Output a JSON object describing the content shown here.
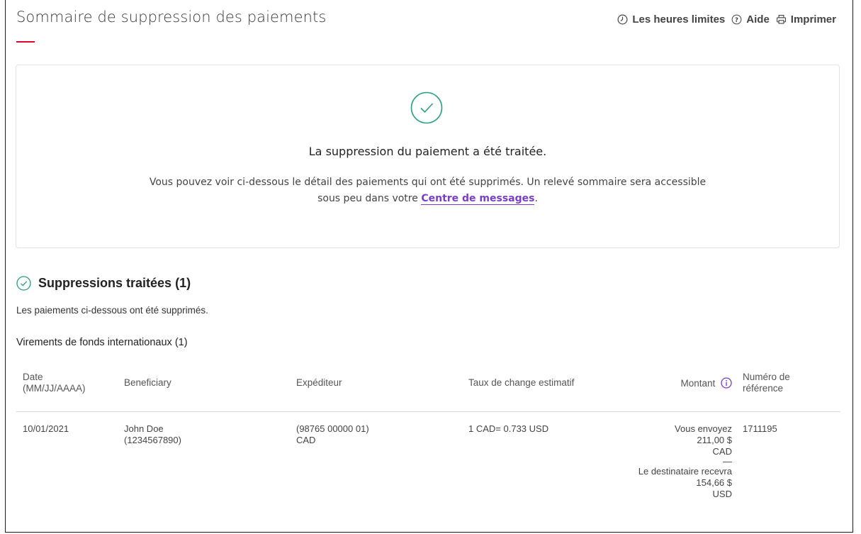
{
  "header": {
    "title": "Sommaire de suppression des paiements",
    "links": [
      {
        "label": "Les heures limites",
        "icon": "clock-icon"
      },
      {
        "label": "Aide",
        "icon": "help-icon"
      },
      {
        "label": "Imprimer",
        "icon": "print-icon"
      }
    ]
  },
  "confirmation": {
    "icon": "check-circle-icon",
    "heading": "La suppression du paiement a été traitée.",
    "text_before": "Vous pouvez voir ci-dessous le détail des paiements qui ont été supprimés. Un relevé sommaire sera accessible sous peu dans votre",
    "link_label": "Centre de messages",
    "text_after": "."
  },
  "section": {
    "heading": "Suppressions traitées (1)",
    "subtext": "Les paiements ci-dessous ont été supprimés.",
    "group_title": "Virements de fonds internationaux (1)"
  },
  "table": {
    "headers": {
      "date_line1": "Date",
      "date_line2": "(MM/JJ/AAAA)",
      "beneficiary": "Beneficiary",
      "sender": "Expéditeur",
      "rate": "Taux de change estimatif",
      "amount": "Montant",
      "ref_line1": "Numéro de",
      "ref_line2": "référence"
    },
    "rows": [
      {
        "date": "10/01/2021",
        "beneficiary_name": "John Doe",
        "beneficiary_account": "(1234567890)",
        "sender_account": "(98765 00000 01)",
        "sender_currency": "CAD",
        "rate": "1 CAD= 0.733 USD",
        "send_label": "Vous envoyez",
        "send_amount": "211,00 $",
        "send_currency": "CAD",
        "separator": "—",
        "receive_label": "Le destinataire recevra",
        "receive_amount": "154,66 $",
        "receive_currency": "USD",
        "reference": "1711195"
      }
    ]
  },
  "colors": {
    "accent_red": "#e4002b",
    "success_green": "#2aa084",
    "link_purple": "#7b3ec8"
  }
}
